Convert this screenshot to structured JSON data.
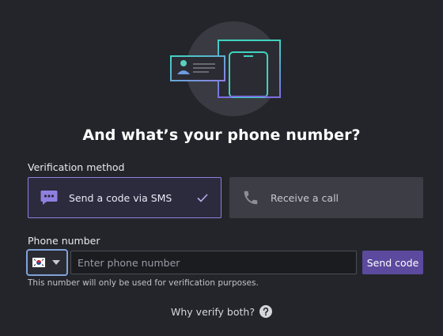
{
  "header": {
    "title": "And what’s your phone number?"
  },
  "verification": {
    "label": "Verification method",
    "options": [
      {
        "label": "Send a code via SMS",
        "icon": "sms-icon",
        "selected": true
      },
      {
        "label": "Receive a call",
        "icon": "phone-icon",
        "selected": false
      }
    ]
  },
  "phone": {
    "label": "Phone number",
    "country_flag": "south-korea-flag-icon",
    "value": "",
    "placeholder": "Enter phone number",
    "send_label": "Send code",
    "hint": "This number will only be used for verification purposes."
  },
  "footer": {
    "why_label": "Why verify both?"
  },
  "colors": {
    "background": "#24252a",
    "accent": "#8f7fe0",
    "send_button": "#5b4a9e",
    "teal": "#3fd3c0"
  }
}
